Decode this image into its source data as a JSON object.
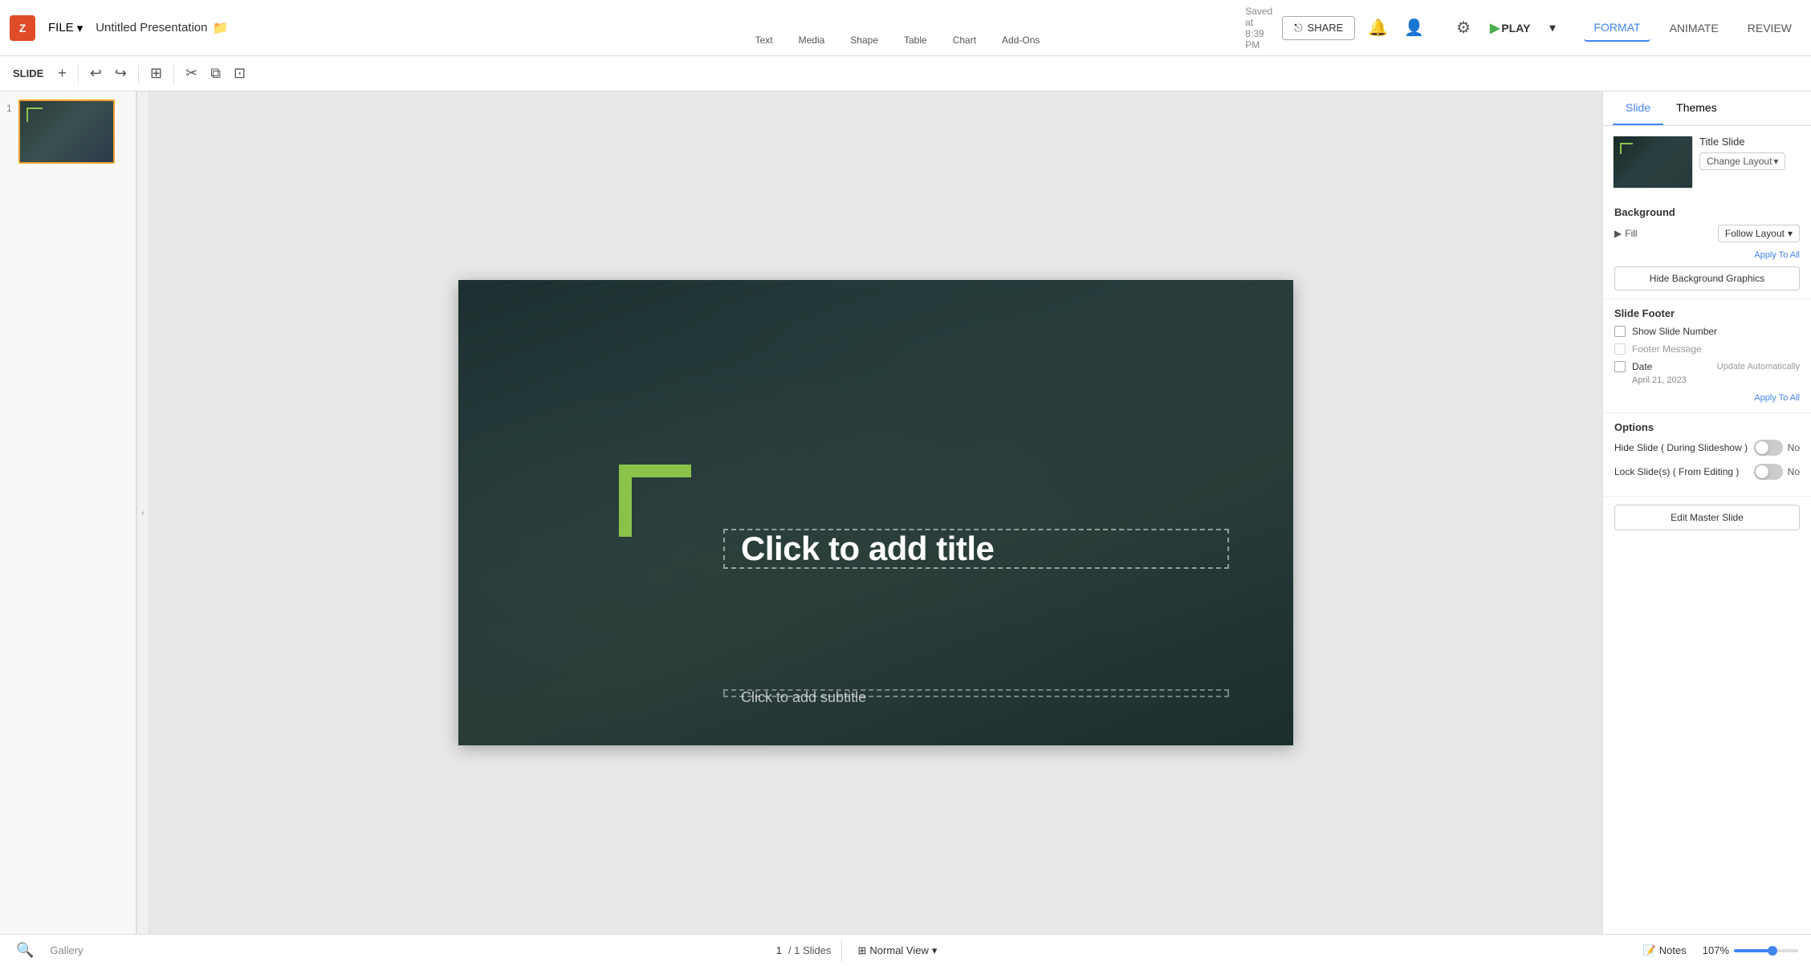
{
  "app": {
    "logo": "Z",
    "file_menu": "FILE",
    "title": "Untitled Presentation",
    "title_icon": "📁",
    "saved_text": "Saved at 8:39 PM",
    "share_label": "SHARE"
  },
  "toolbar": {
    "undo_label": "↩",
    "redo_label": "↪",
    "layout_label": "⊞",
    "cut_label": "✂",
    "copy_label": "⧉",
    "paste_label": "⊡",
    "text_label": "Text",
    "media_label": "Media",
    "shape_label": "Shape",
    "table_label": "Table",
    "chart_label": "Chart",
    "addons_label": "Add-Ons"
  },
  "playbar": {
    "settings_icon": "⚙",
    "play_label": "PLAY",
    "dropdown_icon": "▾"
  },
  "tabs": {
    "format": "FORMAT",
    "animate": "ANIMATE",
    "review": "REVIEW"
  },
  "slide": {
    "number": "1",
    "slide_label": "SLIDE",
    "title_placeholder": "Click to add title",
    "subtitle_placeholder": "Click to add subtitle"
  },
  "right_panel": {
    "tabs": [
      "Slide",
      "Themes"
    ],
    "active_tab": "Slide",
    "slide_name": "Title Slide",
    "change_layout_label": "Change Layout",
    "background_title": "Background",
    "fill_label": "Fill",
    "fill_value": "Follow Layout",
    "apply_to_all": "Apply To All",
    "hide_bg_graphics": "Hide Background Graphics",
    "footer_title": "Slide Footer",
    "show_slide_number": "Show Slide Number",
    "footer_message": "Footer Message",
    "date_label": "Date",
    "update_auto": "Update Automatically",
    "date_value": "April 21, 2023",
    "footer_apply": "Apply To All",
    "options_title": "Options",
    "hide_slide_label": "Hide Slide ( During Slideshow )",
    "lock_slide_label": "Lock Slide(s) ( From Editing )",
    "toggle_no": "No",
    "edit_master": "Edit Master Slide"
  },
  "bottom_bar": {
    "gallery_label": "Gallery",
    "slide_current": "1",
    "slide_total": "/ 1 Slides",
    "view_label": "Normal View",
    "notes_label": "Notes",
    "zoom_level": "107%"
  }
}
